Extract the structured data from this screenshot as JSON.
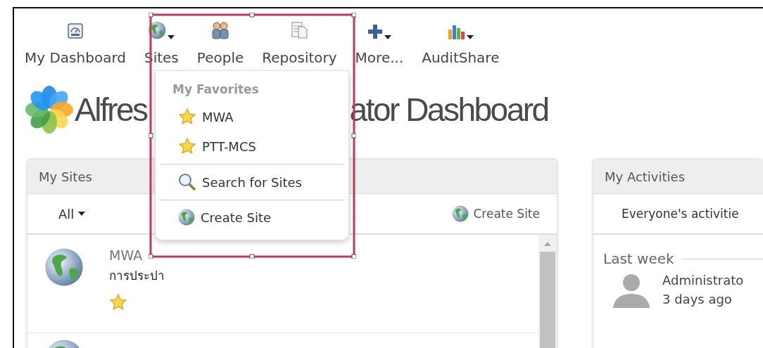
{
  "nav": [
    {
      "label": "My Dashboard",
      "has_menu": false
    },
    {
      "label": "Sites",
      "has_menu": true
    },
    {
      "label": "People",
      "has_menu": false
    },
    {
      "label": "Repository",
      "has_menu": false
    },
    {
      "label": "More...",
      "has_menu": true
    },
    {
      "label": "AuditShare",
      "has_menu": true
    }
  ],
  "title_parts": [
    "Alfres",
    "ator Dashboard"
  ],
  "sites_menu": {
    "section": "My Favorites",
    "favorites": [
      {
        "label": "MWA"
      },
      {
        "label": "PTT-MCS"
      }
    ],
    "actions": [
      {
        "label": "Search for Sites"
      },
      {
        "label": "Create Site"
      }
    ]
  },
  "my_sites": {
    "title": "My Sites",
    "filter": "All",
    "create": "Create Site",
    "sites": [
      {
        "kind": "site",
        "name": "MWA",
        "description": "การประปา",
        "favorite": true
      },
      {
        "kind": "partial"
      }
    ]
  },
  "my_activities": {
    "title": "My Activities",
    "filter": "Everyone's activitie",
    "groups": [
      {
        "label": "Last week",
        "items": [
          {
            "user": "Administrato",
            "time": "3 days ago"
          }
        ]
      }
    ]
  }
}
